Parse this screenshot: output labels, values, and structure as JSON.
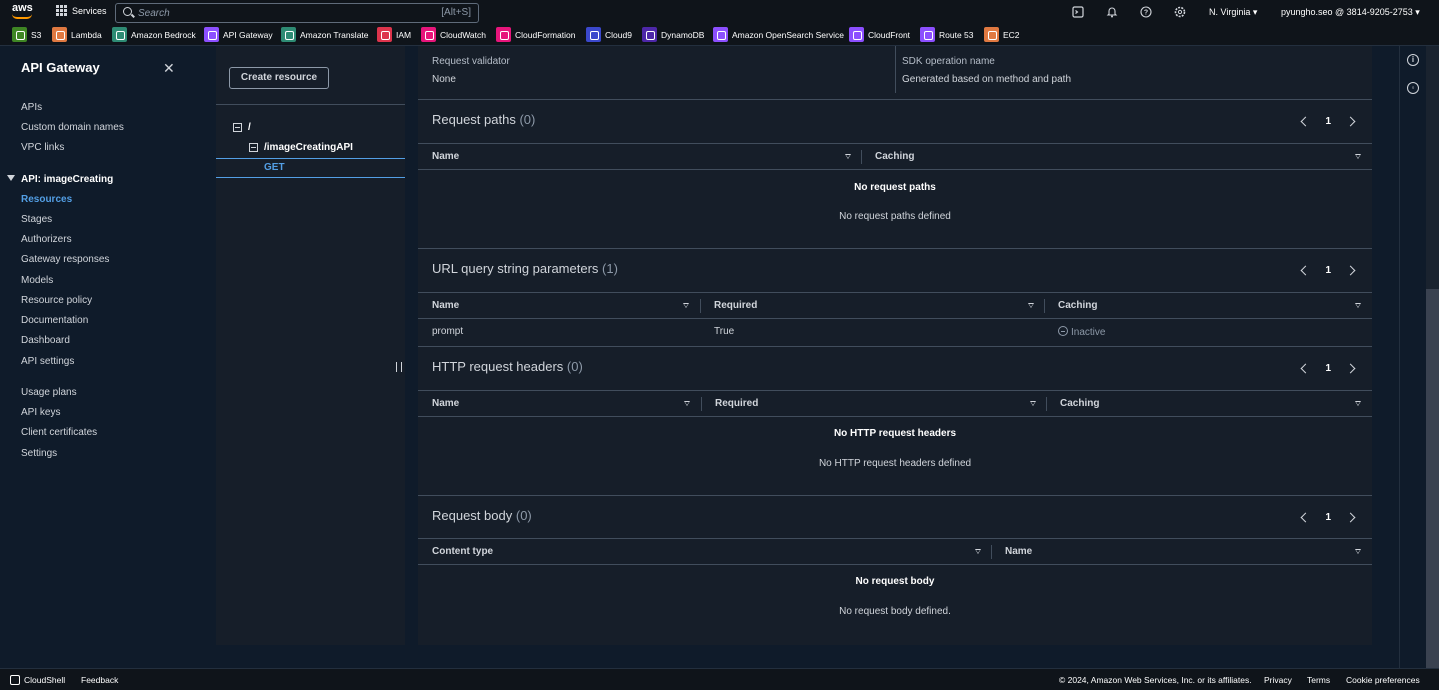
{
  "topbar": {
    "services_label": "Services",
    "search_placeholder": "Search",
    "search_shortcut": "[Alt+S]",
    "region": "N. Virginia ▾",
    "account": "pyungho.seo @ 3814-9205-2753 ▾"
  },
  "favorites": [
    {
      "label": "S3",
      "color": "#3f8624"
    },
    {
      "label": "Lambda",
      "color": "#e07941"
    },
    {
      "label": "Amazon Bedrock",
      "color": "#2e8b74"
    },
    {
      "label": "API Gateway",
      "color": "#8c4fff"
    },
    {
      "label": "Amazon Translate",
      "color": "#2e8b74"
    },
    {
      "label": "IAM",
      "color": "#dd344c"
    },
    {
      "label": "CloudWatch",
      "color": "#e7157b"
    },
    {
      "label": "CloudFormation",
      "color": "#e7157b"
    },
    {
      "label": "Cloud9",
      "color": "#3b48cc"
    },
    {
      "label": "DynamoDB",
      "color": "#4d27a8"
    },
    {
      "label": "Amazon OpenSearch Service",
      "color": "#8c4fff"
    },
    {
      "label": "CloudFront",
      "color": "#8c4fff"
    },
    {
      "label": "Route 53",
      "color": "#8c4fff"
    },
    {
      "label": "EC2",
      "color": "#e07941"
    }
  ],
  "sidebar": {
    "title": "API Gateway",
    "top_items": [
      "APIs",
      "Custom domain names",
      "VPC links"
    ],
    "api_section": "API: imageCreating",
    "api_items": [
      "Resources",
      "Stages",
      "Authorizers",
      "Gateway responses",
      "Models",
      "Resource policy",
      "Documentation",
      "Dashboard",
      "API settings"
    ],
    "bottom_items": [
      "Usage plans",
      "API keys",
      "Client certificates",
      "Settings"
    ]
  },
  "tree": {
    "create_button": "Create resource",
    "root": "/",
    "child": "/imageCreatingAPI",
    "method": "GET"
  },
  "main": {
    "validator_label": "Request validator",
    "validator_value": "None",
    "sdk_label": "SDK operation name",
    "sdk_value": "Generated based on method and path",
    "request_paths": {
      "title": "Request paths",
      "count": "(0)",
      "page": "1",
      "col_name": "Name",
      "col_caching": "Caching",
      "empty_title": "No request paths",
      "empty_sub": "No request paths defined"
    },
    "query_params": {
      "title": "URL query string parameters",
      "count": "(1)",
      "page": "1",
      "col_name": "Name",
      "col_required": "Required",
      "col_caching": "Caching",
      "rows": [
        {
          "name": "prompt",
          "required": "True",
          "caching": "Inactive"
        }
      ]
    },
    "headers": {
      "title": "HTTP request headers",
      "count": "(0)",
      "page": "1",
      "col_name": "Name",
      "col_required": "Required",
      "col_caching": "Caching",
      "empty_title": "No HTTP request headers",
      "empty_sub": "No HTTP request headers defined"
    },
    "body": {
      "title": "Request body",
      "count": "(0)",
      "page": "1",
      "col_content": "Content type",
      "col_name": "Name",
      "empty_title": "No request body",
      "empty_sub": "No request body defined."
    }
  },
  "footer": {
    "cloudshell": "CloudShell",
    "feedback": "Feedback",
    "copyright": "© 2024, Amazon Web Services, Inc. or its affiliates.",
    "privacy": "Privacy",
    "terms": "Terms",
    "cookies": "Cookie preferences"
  }
}
